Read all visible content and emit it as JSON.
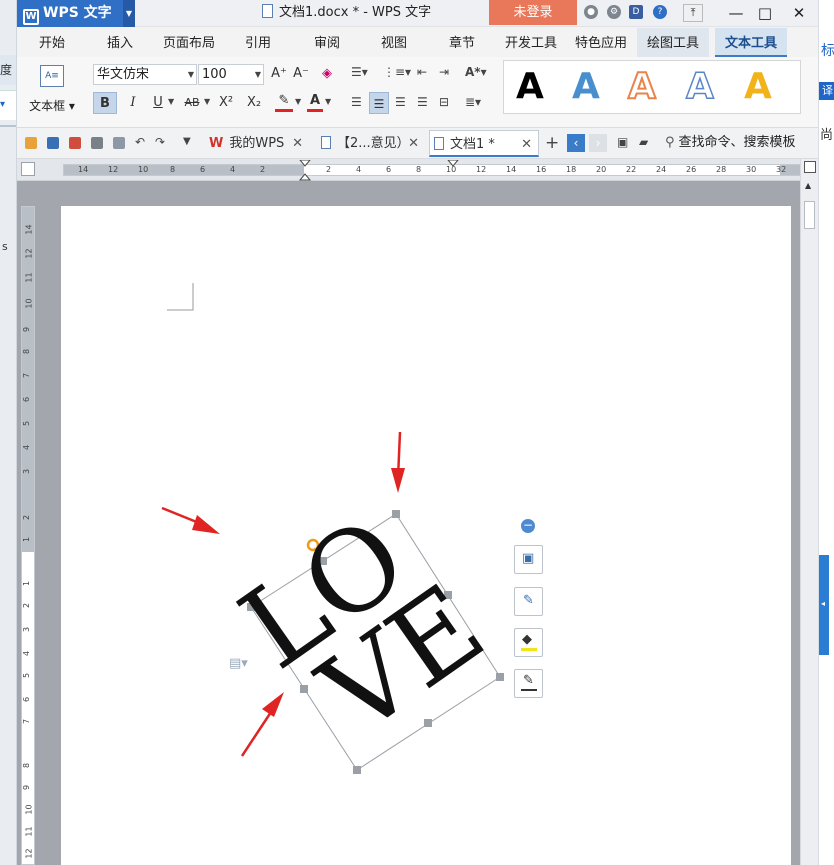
{
  "app": {
    "name": "WPS 文字",
    "doc_title": "文档1.docx * - WPS 文字",
    "login_label": "未登录"
  },
  "menu": {
    "items": [
      "开始",
      "插入",
      "页面布局",
      "引用",
      "审阅",
      "视图",
      "章节",
      "开发工具",
      "特色应用"
    ],
    "context_tab": "绘图工具",
    "active_tab": "文本工具"
  },
  "ribbon": {
    "textbox_label": "文本框",
    "font_name": "华文仿宋",
    "font_size": "100",
    "bold": "B",
    "italic": "I",
    "underline": "U",
    "strike": "AB",
    "superscript": "X²",
    "subscript": "X₂",
    "grow_font": "A⁺",
    "shrink_font": "A⁻",
    "wordart_styles": [
      {
        "glyph": "A",
        "color": "#000000"
      },
      {
        "glyph": "A",
        "color": "#4a8fcd"
      },
      {
        "glyph": "A",
        "color": "#e9834a"
      },
      {
        "glyph": "A",
        "color": "#5b86c7"
      },
      {
        "glyph": "A",
        "color": "#f2b21a"
      }
    ]
  },
  "tabs": {
    "items": [
      "我的WPS",
      "【2...意见）",
      "文档1 *"
    ],
    "search_placeholder": "查找命令、搜索模板"
  },
  "ruler": {
    "h_numbers": [
      "14",
      "12",
      "10",
      "8",
      "6",
      "4",
      "2",
      "2",
      "4",
      "6",
      "8",
      "10",
      "12",
      "14",
      "16",
      "18",
      "20",
      "22",
      "24",
      "26",
      "28",
      "30",
      "32"
    ],
    "v_numbers": [
      "14",
      "12",
      "11",
      "10",
      "9",
      "8",
      "7",
      "6",
      "5",
      "4",
      "3",
      "2",
      "1",
      "1",
      "2",
      "3",
      "4",
      "5",
      "6",
      "7",
      "8",
      "9",
      "10",
      "11",
      "12",
      "13"
    ]
  },
  "document": {
    "wordart_line1": "LO",
    "wordart_line2": "VE"
  },
  "left_strip": {
    "text1": "度",
    "text2": "▾",
    "text3": "s"
  },
  "right_strip": {
    "text1": "标",
    "text2": "译",
    "text3": "尚"
  },
  "colors": {
    "accent_blue": "#2f6fc6",
    "login_orange": "#e9785a",
    "arrow_red": "#e02424"
  }
}
